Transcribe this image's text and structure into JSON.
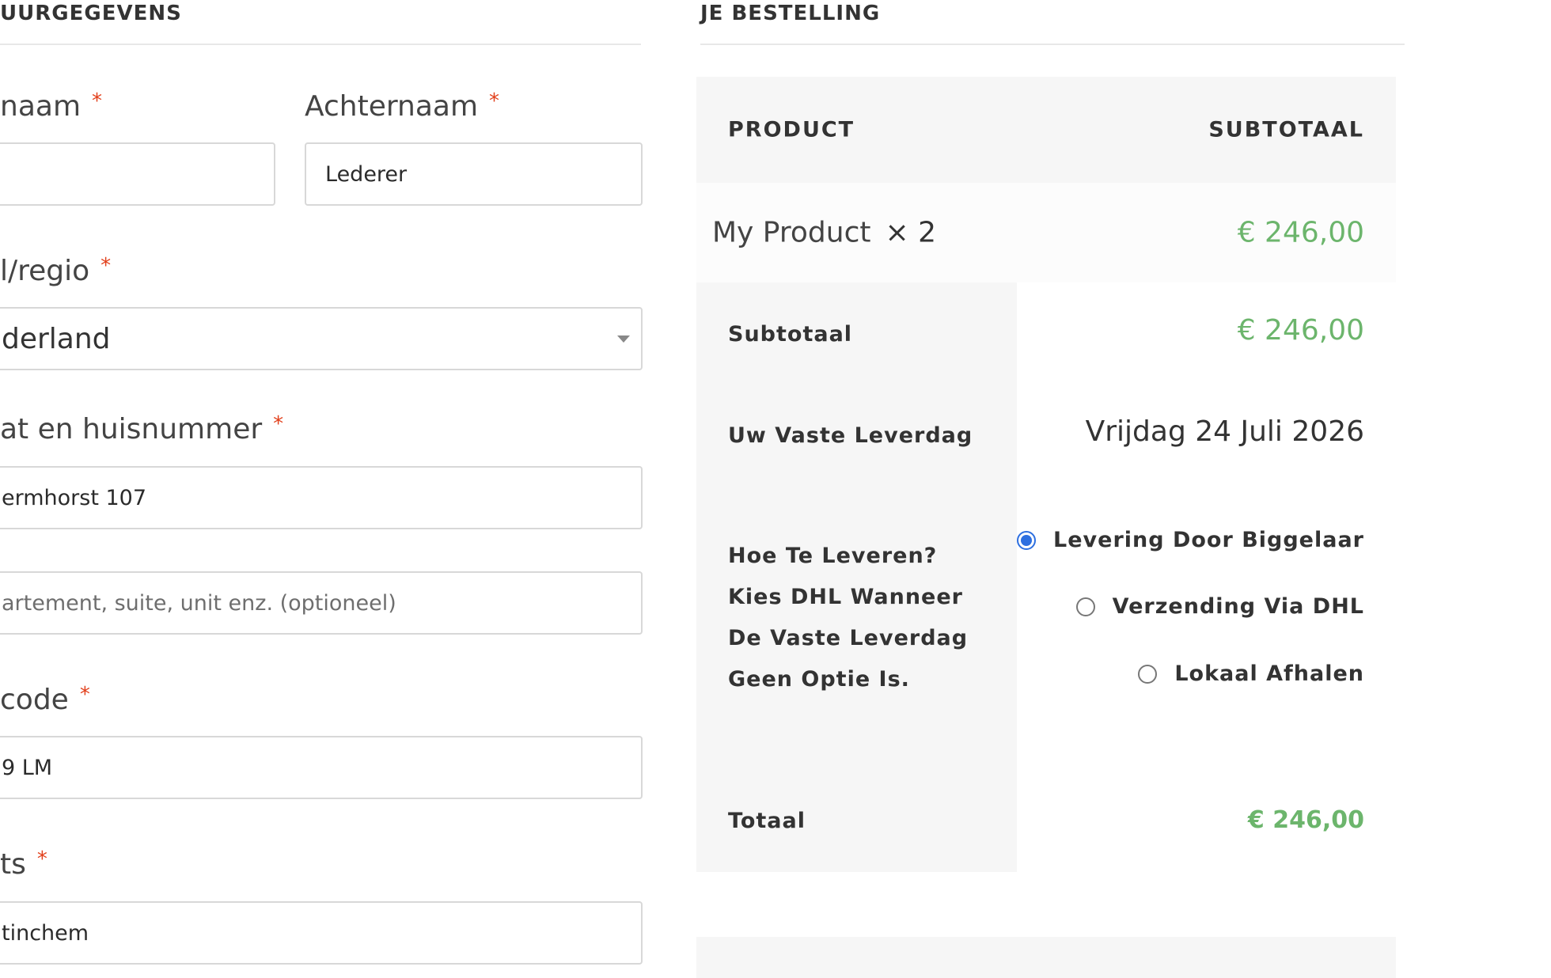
{
  "billing": {
    "heading": "UURGEGEVENS",
    "first_name": {
      "label": "naam",
      "required": "*",
      "value": ""
    },
    "last_name": {
      "label": "Achternaam",
      "required": "*",
      "value": "Lederer"
    },
    "country": {
      "label": "l/regio",
      "required": "*",
      "value": "derland"
    },
    "street": {
      "label": "at en huisnummer",
      "required": "*",
      "value": "ermhorst 107"
    },
    "address2": {
      "placeholder": "artement, suite, unit enz. (optioneel)"
    },
    "postcode": {
      "label": "code",
      "required": "*",
      "value": "9 LM"
    },
    "city": {
      "label": "ts",
      "required": "*",
      "value": "tinchem"
    }
  },
  "order": {
    "heading": "JE BESTELLING",
    "col_product": "PRODUCT",
    "col_subtotal": "SUBTOTAAL",
    "items": [
      {
        "name": "My Product",
        "qty": "× 2",
        "price": "€ 246,00"
      }
    ],
    "subtotal_label": "Subtotaal",
    "subtotal_value": "€ 246,00",
    "delivery_day_label": "Uw Vaste Leverdag",
    "delivery_day_value": "Vrijdag 24 Juli 2026",
    "shipping_label": "Hoe Te Leveren? Kies DHL Wanneer De Vaste Leverdag Geen Optie Is.",
    "shipping_options": [
      {
        "label": "Levering Door Biggelaar",
        "selected": true
      },
      {
        "label": "Verzending Via DHL",
        "selected": false
      },
      {
        "label": "Lokaal Afhalen",
        "selected": false
      }
    ],
    "total_label": "Totaal",
    "total_value": "€ 246,00"
  },
  "colors": {
    "price_green": "#6cb56c",
    "required_red": "#e2401c",
    "radio_blue": "#2d6fe0",
    "table_bg": "#f6f6f6"
  },
  "icons": {
    "select_arrow": "chevron-down-icon",
    "radio": "radio-button"
  }
}
